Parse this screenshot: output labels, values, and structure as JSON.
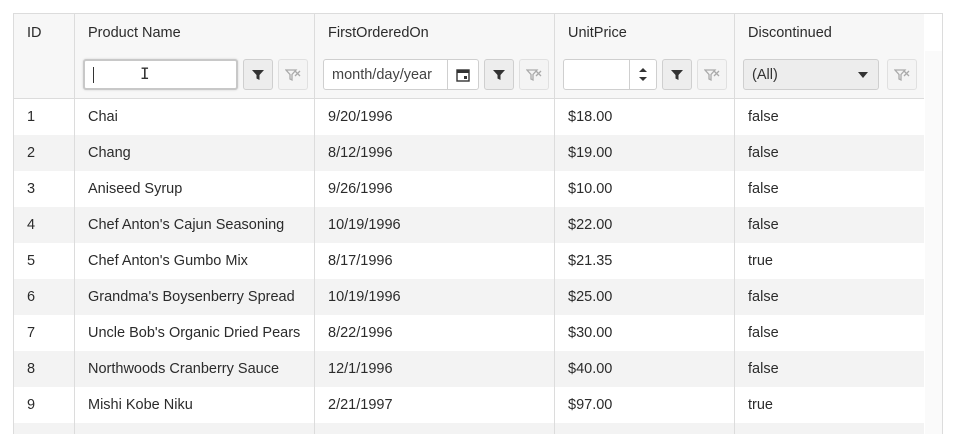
{
  "columns": {
    "id": "ID",
    "name": "Product Name",
    "date": "FirstOrderedOn",
    "price": "UnitPrice",
    "disc": "Discontinued"
  },
  "filters": {
    "name_value": "",
    "date_placeholder": "month/day/year",
    "price_value": "",
    "disc_selected": "(All)"
  },
  "rows": [
    {
      "id": "1",
      "name": "Chai",
      "date": "9/20/1996",
      "price": "$18.00",
      "disc": "false"
    },
    {
      "id": "2",
      "name": "Chang",
      "date": "8/12/1996",
      "price": "$19.00",
      "disc": "false"
    },
    {
      "id": "3",
      "name": "Aniseed Syrup",
      "date": "9/26/1996",
      "price": "$10.00",
      "disc": "false"
    },
    {
      "id": "4",
      "name": "Chef Anton's Cajun Seasoning",
      "date": "10/19/1996",
      "price": "$22.00",
      "disc": "false"
    },
    {
      "id": "5",
      "name": "Chef Anton's Gumbo Mix",
      "date": "8/17/1996",
      "price": "$21.35",
      "disc": "true"
    },
    {
      "id": "6",
      "name": "Grandma's Boysenberry Spread",
      "date": "10/19/1996",
      "price": "$25.00",
      "disc": "false"
    },
    {
      "id": "7",
      "name": "Uncle Bob's Organic Dried Pears",
      "date": "8/22/1996",
      "price": "$30.00",
      "disc": "false"
    },
    {
      "id": "8",
      "name": "Northwoods Cranberry Sauce",
      "date": "12/1/1996",
      "price": "$40.00",
      "disc": "false"
    },
    {
      "id": "9",
      "name": "Mishi Kobe Niku",
      "date": "2/21/1997",
      "price": "$97.00",
      "disc": "true"
    }
  ],
  "icons": {
    "filter": "filter-icon",
    "clear_filter": "clear-filter-icon",
    "calendar": "calendar-icon",
    "spinner": "spinner-arrows-icon",
    "dropdown": "chevron-down-icon"
  }
}
